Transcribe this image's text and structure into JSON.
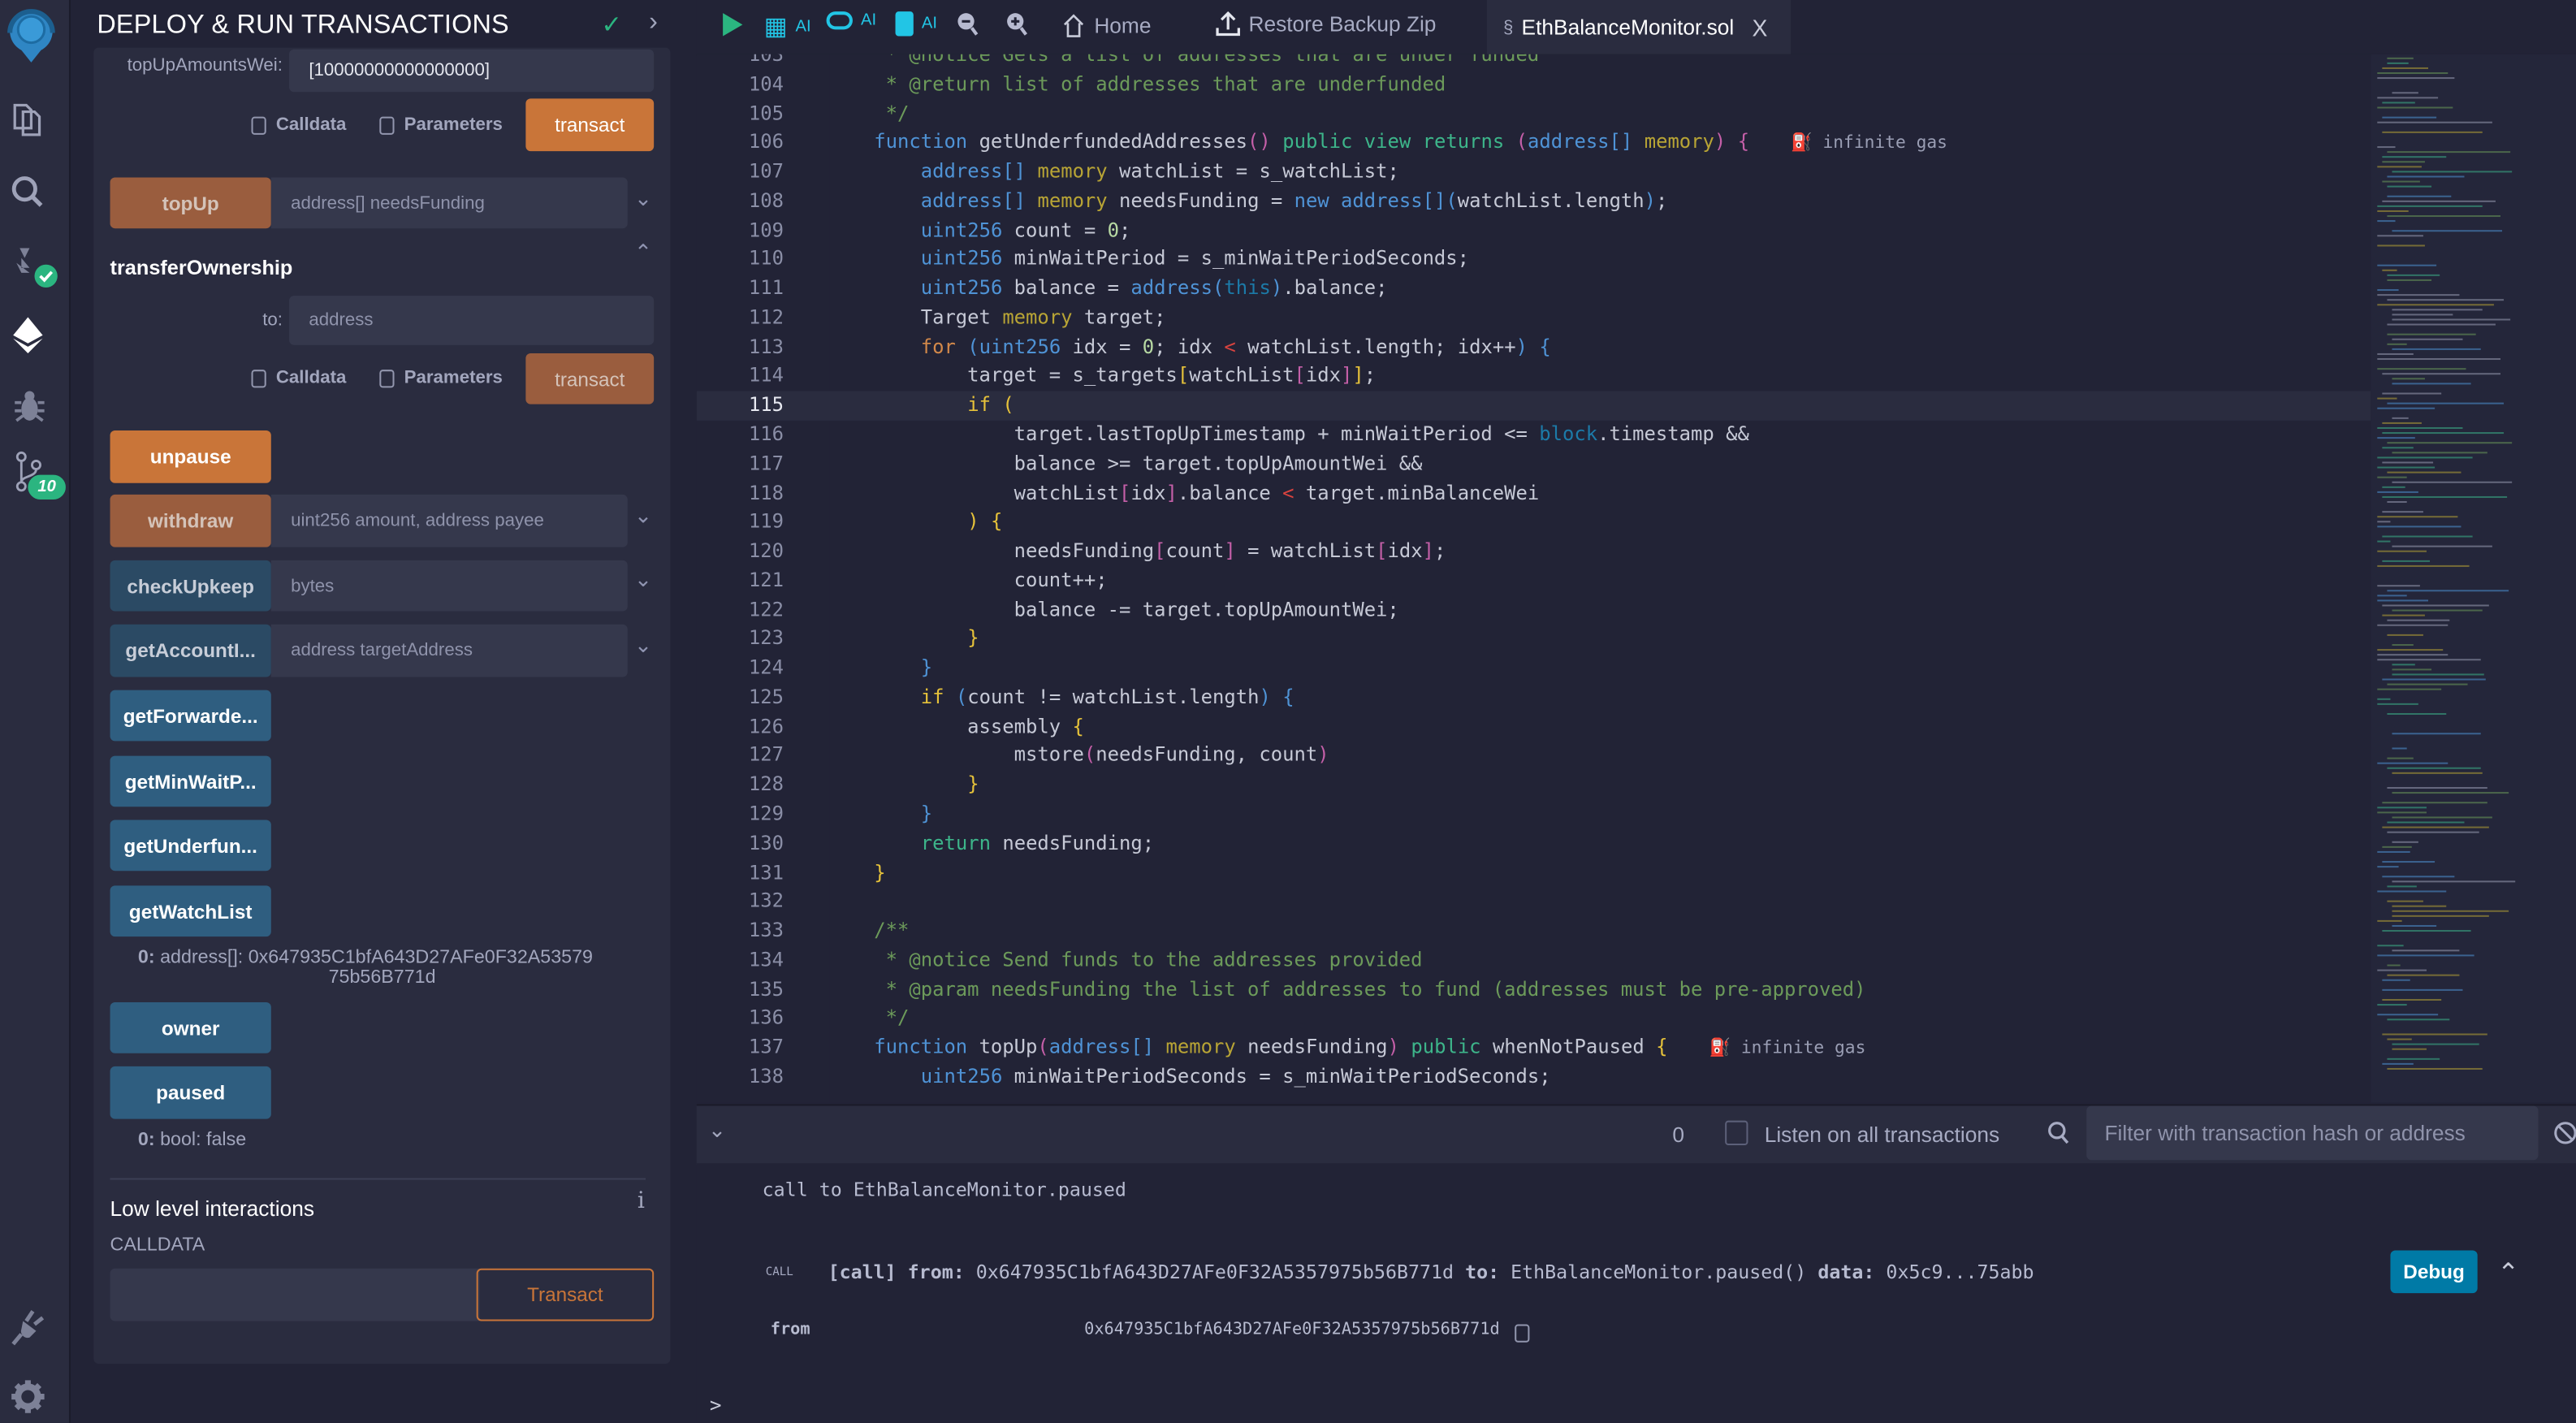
{
  "colors": {
    "accent_orange": "#c97539",
    "button_blue": "#2f5e80",
    "debug_blue": "#007aa6",
    "success_green": "#2bb580",
    "bg_dark": "#222336",
    "bg_panel": "#2a2c3f"
  },
  "sidebar": {
    "icons": [
      "remix-logo-icon",
      "file-explorer-icon",
      "search-icon",
      "solidity-compiler-icon",
      "deploy-run-icon",
      "debugger-icon",
      "git-icon",
      "plugin-manager-icon",
      "settings-icon"
    ],
    "git_badge": "10"
  },
  "panel": {
    "title": "DEPLOY & RUN TRANSACTIONS",
    "top_up_amounts_label": "topUpAmountsWei:",
    "top_up_amounts_value": "[10000000000000000]",
    "calldata_label": "Calldata",
    "parameters_label": "Parameters",
    "transact_label": "transact",
    "topup": {
      "label": "topUp",
      "placeholder": "address[] needsFunding"
    },
    "transfer_ownership": {
      "title": "transferOwnership",
      "to_label": "to:",
      "to_placeholder": "address"
    },
    "unpause": "unpause",
    "withdraw": {
      "label": "withdraw",
      "placeholder": "uint256 amount, address payee"
    },
    "check_upkeep": {
      "label": "checkUpkeep",
      "placeholder": "bytes"
    },
    "get_account_info": {
      "label": "getAccountI...",
      "placeholder": "address targetAddress"
    },
    "get_forwarder": "getForwarde...",
    "get_min_wait": "getMinWaitP...",
    "get_underfunded": "getUnderfun...",
    "get_watch_list": "getWatchList",
    "watch_list_result": {
      "index": "0:",
      "line1": "address[]: 0x647935C1bfA643D27AFe0F32A53579",
      "line2": "75b56B771d"
    },
    "owner": "owner",
    "paused": "paused",
    "paused_result": {
      "index": "0:",
      "value": "bool: false"
    },
    "low_level_title": "Low level interactions",
    "info": "i",
    "calldata_caps": "CALLDATA",
    "low_level_transact": "Transact"
  },
  "toolbar": {
    "ai_label": "AI",
    "home": "Home",
    "restore": "Restore Backup Zip",
    "active_tab": "EthBalanceMonitor.sol",
    "close": "X"
  },
  "editor": {
    "first_line": 103,
    "current_line": 115,
    "gas_hint": "infinite gas",
    "gas_hint_lines": [
      106,
      137
    ],
    "lines": [
      [
        [
          "c",
          " * @notice Gets a list of addresses that are under funded"
        ]
      ],
      [
        [
          "c",
          " * @return list of addresses that are underfunded"
        ]
      ],
      [
        [
          "c",
          " */"
        ]
      ],
      [
        [
          "k",
          "function"
        ],
        [
          "",
          " getUnderfundedAddresses"
        ],
        [
          "pk",
          "()"
        ],
        [
          "",
          " "
        ],
        [
          "v",
          "public view returns"
        ],
        [
          "",
          " "
        ],
        [
          "pk",
          "("
        ],
        [
          "k",
          "address"
        ],
        [
          "p",
          "[]"
        ],
        [
          "",
          " "
        ],
        [
          "m",
          "memory"
        ],
        [
          "pk",
          ")"
        ],
        [
          "",
          " "
        ],
        [
          "pk",
          "{"
        ]
      ],
      [
        [
          "",
          "    "
        ],
        [
          "k",
          "address"
        ],
        [
          "p",
          "[]"
        ],
        [
          "",
          " "
        ],
        [
          "m",
          "memory"
        ],
        [
          "",
          " watchList = s_watchList;"
        ]
      ],
      [
        [
          "",
          "    "
        ],
        [
          "k",
          "address"
        ],
        [
          "p",
          "[]"
        ],
        [
          "",
          " "
        ],
        [
          "m",
          "memory"
        ],
        [
          "",
          " needsFunding = "
        ],
        [
          "k",
          "new address"
        ],
        [
          "p",
          "[]("
        ],
        [
          "",
          "watchList.length"
        ],
        [
          "p",
          ")"
        ],
        [
          "",
          ";"
        ]
      ],
      [
        [
          "",
          "    "
        ],
        [
          "k",
          "uint256"
        ],
        [
          "",
          " count = "
        ],
        [
          "n",
          "0"
        ],
        [
          "",
          ";"
        ]
      ],
      [
        [
          "",
          "    "
        ],
        [
          "k",
          "uint256"
        ],
        [
          "",
          " minWaitPeriod = s_minWaitPeriodSeconds;"
        ]
      ],
      [
        [
          "",
          "    "
        ],
        [
          "k",
          "uint256"
        ],
        [
          "",
          " balance = "
        ],
        [
          "k",
          "address"
        ],
        [
          "p",
          "("
        ],
        [
          "t",
          "this"
        ],
        [
          "p",
          ")"
        ],
        [
          "",
          ".balance;"
        ]
      ],
      [
        [
          "",
          "    Target "
        ],
        [
          "m",
          "memory"
        ],
        [
          "",
          " target;"
        ]
      ],
      [
        [
          "",
          "    "
        ],
        [
          "ctl",
          "for"
        ],
        [
          "",
          " "
        ],
        [
          "p",
          "("
        ],
        [
          "k",
          "uint256"
        ],
        [
          "",
          " idx = "
        ],
        [
          "n",
          "0"
        ],
        [
          "",
          "; idx "
        ],
        [
          "o",
          "<"
        ],
        [
          "",
          " watchList.length; idx++"
        ],
        [
          "p",
          ")"
        ],
        [
          "",
          " "
        ],
        [
          "p",
          "{"
        ]
      ],
      [
        [
          "",
          "        target = s_targets"
        ],
        [
          "y",
          "["
        ],
        [
          "",
          "watchList"
        ],
        [
          "pk",
          "["
        ],
        [
          "",
          "idx"
        ],
        [
          "pk",
          "]"
        ],
        [
          "y",
          "]"
        ],
        [
          "",
          ";"
        ]
      ],
      [
        [
          "",
          "        "
        ],
        [
          "y",
          "if"
        ],
        [
          "",
          " "
        ],
        [
          "y",
          "("
        ]
      ],
      [
        [
          "",
          "            target.lastTopUpTimestamp + minWaitPeriod <= "
        ],
        [
          "t",
          "block"
        ],
        [
          "",
          ".timestamp &&"
        ]
      ],
      [
        [
          "",
          "            balance >= target.topUpAmountWei &&"
        ]
      ],
      [
        [
          "",
          "            watchList"
        ],
        [
          "pk",
          "["
        ],
        [
          "",
          "idx"
        ],
        [
          "pk",
          "]"
        ],
        [
          "",
          ".balance "
        ],
        [
          "o",
          "<"
        ],
        [
          "",
          " target.minBalanceWei"
        ]
      ],
      [
        [
          "",
          "        "
        ],
        [
          "y",
          ")"
        ],
        [
          "",
          " "
        ],
        [
          "y",
          "{"
        ]
      ],
      [
        [
          "",
          "            needsFunding"
        ],
        [
          "pk",
          "["
        ],
        [
          "",
          "count"
        ],
        [
          "pk",
          "]"
        ],
        [
          "",
          " = watchList"
        ],
        [
          "pk",
          "["
        ],
        [
          "",
          "idx"
        ],
        [
          "pk",
          "]"
        ],
        [
          "",
          ";"
        ]
      ],
      [
        [
          "",
          "            count++;"
        ]
      ],
      [
        [
          "",
          "            balance -= target.topUpAmountWei;"
        ]
      ],
      [
        [
          "",
          "        "
        ],
        [
          "y",
          "}"
        ]
      ],
      [
        [
          "",
          "    "
        ],
        [
          "p",
          "}"
        ]
      ],
      [
        [
          "",
          "    "
        ],
        [
          "y",
          "if"
        ],
        [
          "",
          " "
        ],
        [
          "p",
          "("
        ],
        [
          "",
          "count != watchList.length"
        ],
        [
          "p",
          ")"
        ],
        [
          "",
          " "
        ],
        [
          "p",
          "{"
        ]
      ],
      [
        [
          "",
          "        assembly "
        ],
        [
          "y",
          "{"
        ]
      ],
      [
        [
          "",
          "            mstore"
        ],
        [
          "pk",
          "("
        ],
        [
          "",
          "needsFunding, count"
        ],
        [
          "pk",
          ")"
        ]
      ],
      [
        [
          "",
          "        "
        ],
        [
          "y",
          "}"
        ]
      ],
      [
        [
          "",
          "    "
        ],
        [
          "p",
          "}"
        ]
      ],
      [
        [
          "",
          "    "
        ],
        [
          "v",
          "return"
        ],
        [
          "",
          " needsFunding;"
        ]
      ],
      [
        [
          "y",
          "}"
        ]
      ],
      [],
      [
        [
          "c",
          "/**"
        ]
      ],
      [
        [
          "c",
          " * @notice Send funds to the addresses provided"
        ]
      ],
      [
        [
          "c",
          " * @param needsFunding the list of addresses to fund (addresses must be pre-approved)"
        ]
      ],
      [
        [
          "c",
          " */"
        ]
      ],
      [
        [
          "k",
          "function"
        ],
        [
          "",
          " topUp"
        ],
        [
          "pk",
          "("
        ],
        [
          "k",
          "address"
        ],
        [
          "p",
          "[]"
        ],
        [
          "",
          " "
        ],
        [
          "m",
          "memory"
        ],
        [
          "",
          " needsFunding"
        ],
        [
          "pk",
          ")"
        ],
        [
          "",
          " "
        ],
        [
          "v",
          "public"
        ],
        [
          "",
          " whenNotPaused "
        ],
        [
          "y",
          "{"
        ]
      ],
      [
        [
          "",
          "    "
        ],
        [
          "k",
          "uint256"
        ],
        [
          "",
          " minWaitPeriodSeconds = s_minWaitPeriodSeconds;"
        ]
      ]
    ]
  },
  "terminal": {
    "pending_count": "0",
    "listen_label": "Listen on all transactions",
    "listen_checked": false,
    "filter_placeholder": "Filter with transaction hash or address",
    "log_message": "call to EthBalanceMonitor.paused",
    "call_badge": "CALL",
    "call_summary_prefix": "[call]",
    "from_key": "from:",
    "from_value": "0x647935C1bfA643D27AFe0F32A5357975b56B771d",
    "to_key": "to:",
    "to_value": "EthBalanceMonitor.paused()",
    "data_key": "data:",
    "data_value": "0x5c9...75abb",
    "debug_label": "Debug",
    "detail_from_label": "from",
    "detail_from_value": "0x647935C1bfA643D27AFe0F32A5357975b56B771d",
    "prompt": ">"
  }
}
